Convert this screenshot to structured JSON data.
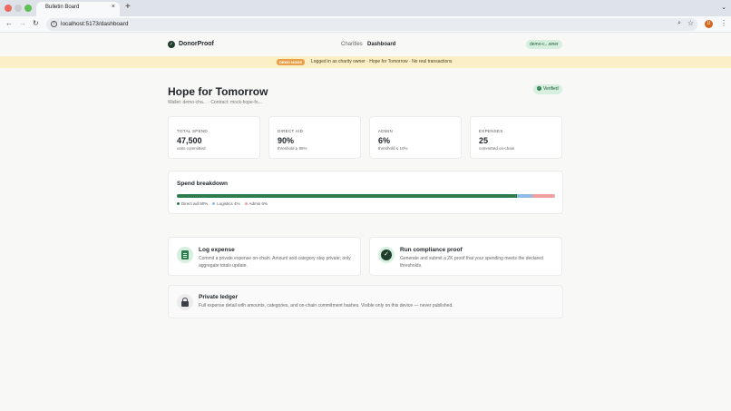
{
  "browser": {
    "tab_title": "Bulletin Board",
    "tab_close": "×",
    "new_tab": "+",
    "tab_menu": "⌄",
    "url": "localhost:5173/dashboard",
    "avatar_initial": "U",
    "icons": [
      "back-icon",
      "forward-icon",
      "reload-icon",
      "site-info-icon",
      "zoom-icon",
      "star-icon",
      "menu-icon"
    ]
  },
  "header": {
    "brand": "DonorProof",
    "nav": [
      "Charities",
      "Dashboard"
    ],
    "active_nav": "Dashboard",
    "wallet": "demo-c...wner"
  },
  "banner": {
    "badge": "DEMO MODE",
    "text": "Logged in as charity owner · Hope for Tomorrow · No real transactions"
  },
  "org": {
    "name": "Hope for Tomorrow",
    "meta": "Wallet: demo-cha... · Contract: mock-hope-fo...",
    "status": "Verified"
  },
  "stats": [
    {
      "label": "TOTAL SPEND",
      "value": "47,500",
      "sub": "units committed"
    },
    {
      "label": "DIRECT AID",
      "value": "90%",
      "sub": "threshold ≥ 85%"
    },
    {
      "label": "ADMIN",
      "value": "6%",
      "sub": "threshold ≤ 10%"
    },
    {
      "label": "EXPENSES",
      "value": "25",
      "sub": "committed on-chain"
    }
  ],
  "breakdown": {
    "title": "Spend breakdown",
    "segments": [
      {
        "name": "Direct aid",
        "percent": 90,
        "label": "Direct aid 90%",
        "color": "#2e7d4f"
      },
      {
        "name": "Logistics",
        "percent": 4,
        "label": "Logistics 4%",
        "color": "#8fbce6"
      },
      {
        "name": "Admin",
        "percent": 6,
        "label": "Admin 6%",
        "color": "#f0a0a0"
      }
    ]
  },
  "actions": [
    {
      "title": "Log expense",
      "desc": "Commit a private expense on-chain. Amount and category stay private; only aggregate totals update."
    },
    {
      "title": "Run compliance proof",
      "desc": "Generate and submit a ZK proof that your spending meets the declared thresholds."
    }
  ],
  "ledger": {
    "title": "Private ledger",
    "desc": "Full expense detail with amounts, categories, and on-chain commitment hashes. Visible only on this device — never published."
  },
  "colors": {
    "accent": "#2e7d4f",
    "banner": "#fbefc5",
    "badge": "#e8a14a"
  }
}
